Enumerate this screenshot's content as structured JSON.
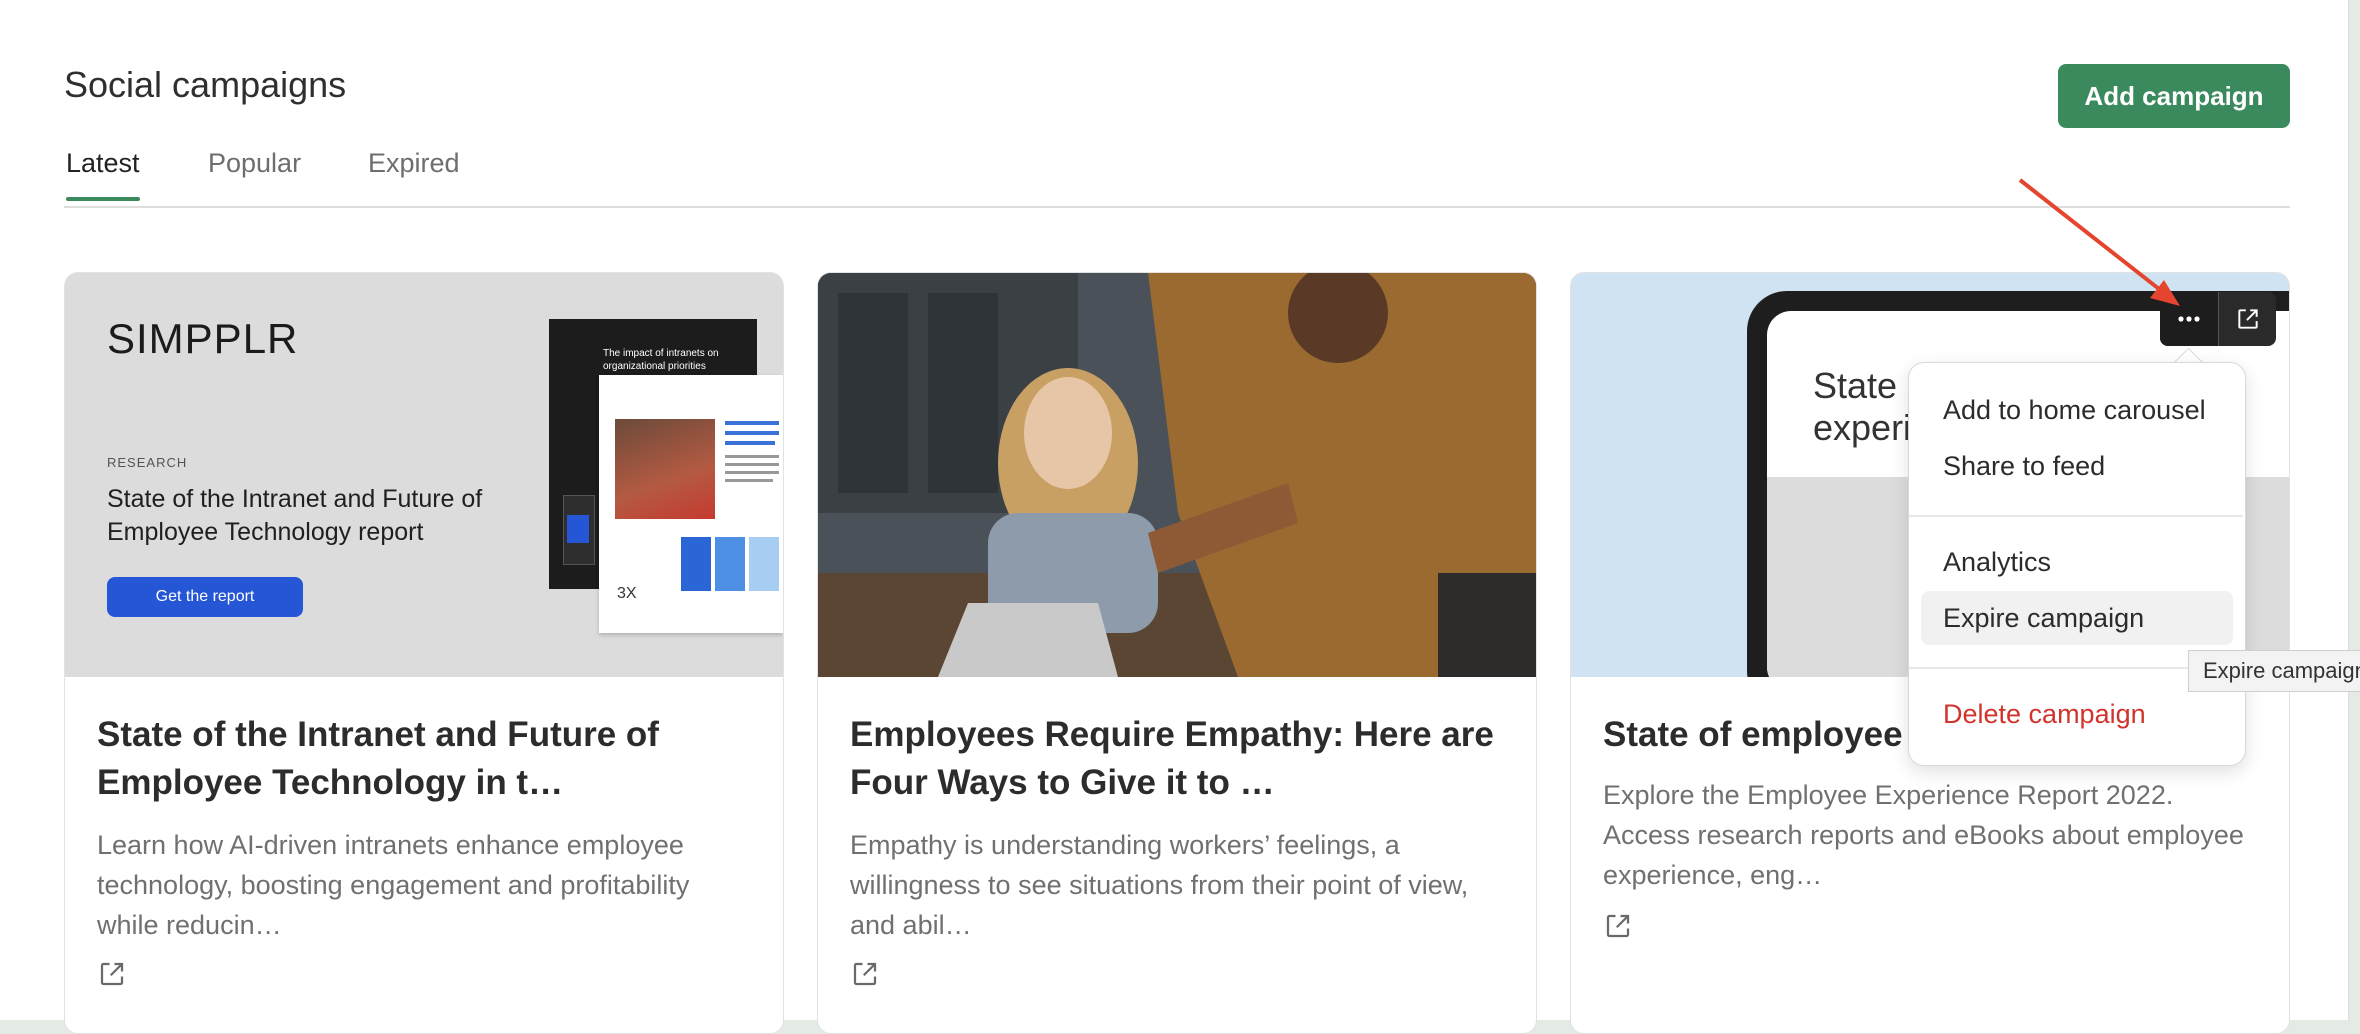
{
  "page": {
    "title": "Social campaigns",
    "add_button_label": "Add campaign"
  },
  "tabs": [
    {
      "label": "Latest",
      "active": true
    },
    {
      "label": "Popular",
      "active": false
    },
    {
      "label": "Expired",
      "active": false
    }
  ],
  "cards": [
    {
      "title": "State of the Intranet and Future of Employee Technology in t…",
      "description": "Learn how AI-driven intranets enhance employee technology, boosting engagement and profitability while reducin…",
      "image": {
        "logo": "SIMPPLR",
        "eyebrow": "RESEARCH",
        "headline": "State of the Intranet and Future of Employee Technology report",
        "cta": "Get the report",
        "doc_title": "The impact of intranets on organizational priorities"
      }
    },
    {
      "title": "Employees Require Empathy: Here are Four Ways to Give it to …",
      "description": "Empathy is understanding workers’ feelings, a willingness to see situations from their point of view, and abil…"
    },
    {
      "title": "State of employee",
      "description": "Explore the Employee Experience Report 2022. Access research reports and eBooks about employee experience, eng…",
      "image": {
        "screen_text": "State o\nexperie"
      }
    }
  ],
  "overlay_buttons": {
    "more_icon": "ellipsis-icon",
    "open_icon": "external-link-icon"
  },
  "menu": {
    "group1": [
      "Add to home carousel",
      "Share to feed"
    ],
    "group2": [
      "Analytics",
      "Expire campaign"
    ],
    "group3": [
      "Delete campaign"
    ],
    "hovered": "Expire campaign"
  },
  "tooltip": "Expire campaign",
  "colors": {
    "accent": "#3a8a5e",
    "danger": "#d0342c",
    "annotation_arrow": "#e5452f",
    "cta_blue": "#2456d6"
  }
}
